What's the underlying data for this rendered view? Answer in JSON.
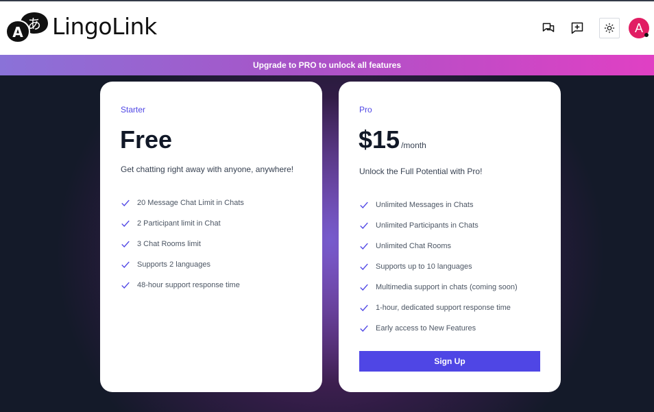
{
  "header": {
    "brand": "LingoLink",
    "logo_glyph_a": "A",
    "logo_glyph_b": "あ",
    "icons": [
      "chats-icon",
      "new-chat-icon",
      "sun-icon"
    ],
    "avatar_initial": "A",
    "avatar_color": "#e11d63"
  },
  "banner": {
    "text": "Upgrade to PRO to unlock all features"
  },
  "plans": [
    {
      "tier": "Starter",
      "price": "Free",
      "period": "",
      "description": "Get chatting right away with anyone, anywhere!",
      "features": [
        "20 Message Chat Limit in Chats",
        "2 Participant limit in Chat",
        "3 Chat Rooms limit",
        "Supports 2 languages",
        "48-hour support response time"
      ]
    },
    {
      "tier": "Pro",
      "price": "$15",
      "period": "/month",
      "description": "Unlock the Full Potential with Pro!",
      "features": [
        "Unlimited Messages in Chats",
        "Unlimited Participants in Chats",
        "Unlimited Chat Rooms",
        "Supports up to 10 languages",
        "Multimedia support in chats (coming soon)",
        "1-hour, dedicated support response time",
        "Early access to New Features"
      ],
      "cta": "Sign Up"
    }
  ],
  "colors": {
    "accent": "#4f46e5",
    "background": "#141a29",
    "banner_start": "#8a72d8",
    "banner_end": "#e040c4"
  }
}
